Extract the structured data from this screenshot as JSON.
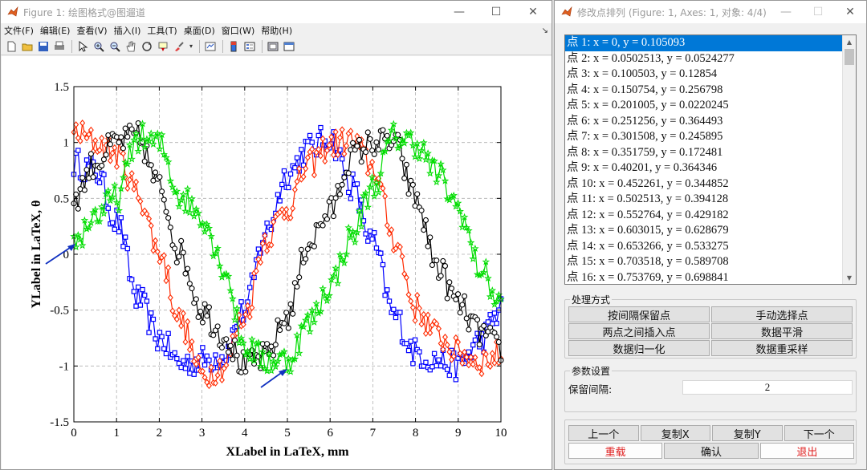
{
  "figure_window": {
    "title": "Figure 1: 绘图格式@图遛道",
    "controls": {
      "minimize": "—",
      "maximize": "☐",
      "close": "✕"
    },
    "menu": [
      "文件(F)",
      "编辑(E)",
      "查看(V)",
      "插入(I)",
      "工具(T)",
      "桌面(D)",
      "窗口(W)",
      "帮助(H)"
    ],
    "toolbar_icons": [
      "new-file-icon",
      "open-folder-icon",
      "save-icon",
      "print-icon",
      "pointer-icon",
      "zoom-in-icon",
      "zoom-out-icon",
      "pan-hand-icon",
      "rotate-icon",
      "data-cursor-icon",
      "brush-icon",
      "link-plot-icon",
      "colorbar-icon",
      "legend-icon",
      "hide-tools-icon",
      "show-tools-icon"
    ]
  },
  "chart_data": {
    "type": "line",
    "xlabel": "XLabel in LaTeX, mm",
    "ylabel": "YLabel in LaTeX, θ",
    "xlim": [
      0,
      10
    ],
    "ylim": [
      -1.5,
      1.5
    ],
    "xticks": [
      "0",
      "1",
      "2",
      "3",
      "4",
      "5",
      "6",
      "7",
      "8",
      "9",
      "10"
    ],
    "yticks": [
      "-1.5",
      "-1",
      "-0.5",
      "0",
      "0.5",
      "1",
      "1.5"
    ],
    "grid": true,
    "series": [
      {
        "color": "#0000ff",
        "marker": "square",
        "x": [
          0,
          0.5,
          1,
          1.5,
          2,
          2.5,
          3,
          3.5,
          4,
          4.5,
          5,
          5.5,
          6,
          6.5,
          7,
          7.5,
          8,
          8.5,
          9,
          9.5,
          10
        ],
        "y": [
          0.82,
          0.75,
          0.3,
          -0.4,
          -0.75,
          -0.98,
          -0.95,
          -0.9,
          -0.5,
          0.2,
          0.72,
          0.95,
          1.05,
          0.62,
          0.1,
          -0.55,
          -0.88,
          -0.95,
          -1.0,
          -0.78,
          -0.5
        ]
      },
      {
        "color": "#ff2a00",
        "marker": "diamond",
        "x": [
          0,
          0.5,
          1,
          1.5,
          2,
          2.5,
          3,
          3.5,
          4,
          4.5,
          5,
          5.5,
          6,
          6.5,
          7,
          7.5,
          8,
          8.5,
          9,
          9.5,
          10
        ],
        "y": [
          1.1,
          1.0,
          0.9,
          0.55,
          0.02,
          -0.6,
          -1.08,
          -1.0,
          -0.55,
          0.15,
          0.42,
          0.8,
          0.98,
          1.02,
          0.78,
          0.15,
          -0.48,
          -0.72,
          -0.88,
          -0.95,
          -0.9
        ]
      },
      {
        "color": "#000000",
        "marker": "circle",
        "x": [
          0,
          0.5,
          1,
          1.5,
          2,
          2.5,
          3,
          3.5,
          4,
          4.5,
          5,
          5.5,
          6,
          6.5,
          7,
          7.5,
          8,
          8.5,
          9,
          9.5,
          10
        ],
        "y": [
          0.5,
          0.82,
          1.0,
          1.05,
          0.6,
          0.0,
          -0.5,
          -0.72,
          -1.0,
          -0.92,
          -0.55,
          0.1,
          0.38,
          0.88,
          1.0,
          1.0,
          0.5,
          -0.1,
          -0.45,
          -0.7,
          -0.85
        ]
      },
      {
        "color": "#00dd00",
        "marker": "star",
        "x": [
          0,
          0.5,
          1,
          1.5,
          2,
          2.5,
          3,
          3.5,
          4,
          4.5,
          5,
          5.5,
          6,
          6.5,
          7,
          7.5,
          8,
          8.5,
          9,
          9.5,
          10
        ],
        "y": [
          0.1,
          0.35,
          0.5,
          1.05,
          0.98,
          0.52,
          0.35,
          -0.1,
          -0.82,
          -0.95,
          -0.95,
          -0.62,
          -0.28,
          0.15,
          0.6,
          1.05,
          1.0,
          0.72,
          0.42,
          -0.12,
          -0.45
        ]
      }
    ]
  },
  "dialog": {
    "title": "修改点排列 (Figure: 1, Axes: 1, 对象: 4/4)",
    "controls": {
      "minimize": "—",
      "maximize": "☐",
      "close": "✕"
    },
    "points": [
      "点 1: x = 0, y = 0.105093",
      "点 2: x = 0.0502513, y = 0.0524277",
      "点 3: x = 0.100503, y = 0.12854",
      "点 4: x = 0.150754, y = 0.256798",
      "点 5: x = 0.201005, y = 0.0220245",
      "点 6: x = 0.251256, y = 0.364493",
      "点 7: x = 0.301508, y = 0.245895",
      "点 8: x = 0.351759, y = 0.172481",
      "点 9: x = 0.40201, y = 0.364346",
      "点 10: x = 0.452261, y = 0.344852",
      "点 11: x = 0.502513, y = 0.394128",
      "点 12: x = 0.552764, y = 0.429182",
      "点 13: x = 0.603015, y = 0.628679",
      "点 14: x = 0.653266, y = 0.533275",
      "点 15: x = 0.703518, y = 0.589708",
      "点 16: x = 0.753769, y = 0.698841"
    ],
    "selected_index": 0,
    "processing": {
      "title": "处理方式",
      "buttons": [
        "按间隔保留点",
        "手动选择点",
        "两点之间插入点",
        "数据平滑",
        "数据归一化",
        "数据重采样"
      ]
    },
    "params": {
      "title": "参数设置",
      "interval_label": "保留间隔:",
      "interval_value": "2"
    },
    "nav": {
      "prev": "上一个",
      "copy_x": "复制X",
      "copy_y": "复制Y",
      "next": "下一个",
      "reload": "重载",
      "confirm": "确认",
      "exit": "退出"
    },
    "accent_color": "#0078d7",
    "danger_color": "#e02020"
  }
}
